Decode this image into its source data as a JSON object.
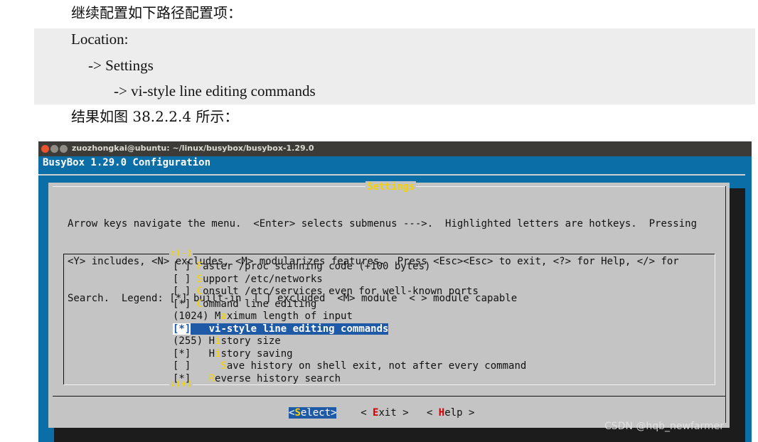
{
  "doc": {
    "intro": "继续配置如下路径配置项：",
    "location_label": "Location:",
    "path_1": "-> Settings",
    "path_2": "-> vi-style line editing commands",
    "result": "结果如图 38.2.2.4 所示："
  },
  "window": {
    "title": "zuozhongkai@ubuntu: ~/linux/busybox/busybox-1.29.0"
  },
  "terminal": {
    "config_title": "BusyBox 1.29.0 Configuration",
    "dialog_title": "Settings",
    "help_lines": [
      "Arrow keys navigate the menu.  <Enter> selects submenus --->.  Highlighted letters are hotkeys.  Pressing",
      "<Y> includes, <N> excludes, <M> modularizes features.  Press <Esc><Esc> to exit, <?> for Help, </> for",
      "Search.  Legend: [*] built-in  [ ] excluded  <M> module  < > module capable"
    ],
    "scroll_up": "↑(-)",
    "scroll_down": "↓(+)",
    "menu": [
      {
        "prefix": "[ ] ",
        "hotkey": "F",
        "rest": "aster /proc scanning code (+100 bytes)"
      },
      {
        "prefix": "[ ] ",
        "hotkey": "S",
        "rest": "upport /etc/networks"
      },
      {
        "prefix": "[ ] ",
        "hotkey": "C",
        "rest": "onsult /etc/services even for well-known ports"
      },
      {
        "prefix": "[*] ",
        "hotkey": "C",
        "rest": "ommand line editing"
      },
      {
        "prefix": "(1024) M",
        "hotkey": "a",
        "rest": "ximum length of input"
      },
      {
        "prefix": "[*]   ",
        "hotkey": "v",
        "rest": "i-style line editing commands",
        "selected": true
      },
      {
        "prefix": "(255) H",
        "hotkey": "i",
        "rest": "story size"
      },
      {
        "prefix": "[*]   H",
        "hotkey": "i",
        "rest": "story saving"
      },
      {
        "prefix": "[ ]     ",
        "hotkey": "S",
        "rest": "ave history on shell exit, not after every command"
      },
      {
        "prefix": "[*]   ",
        "hotkey": "R",
        "rest": "everse history search"
      }
    ],
    "buttons": {
      "select": {
        "open": "<",
        "hotkey": "S",
        "rest": "elect",
        "close": ">"
      },
      "exit": {
        "open": "< ",
        "hotkey": "E",
        "rest": "xit",
        "close": " >"
      },
      "help": {
        "open": "< ",
        "hotkey": "H",
        "rest": "elp",
        "close": " >"
      }
    }
  },
  "watermark": "CSDN @hqb_newfarmer"
}
